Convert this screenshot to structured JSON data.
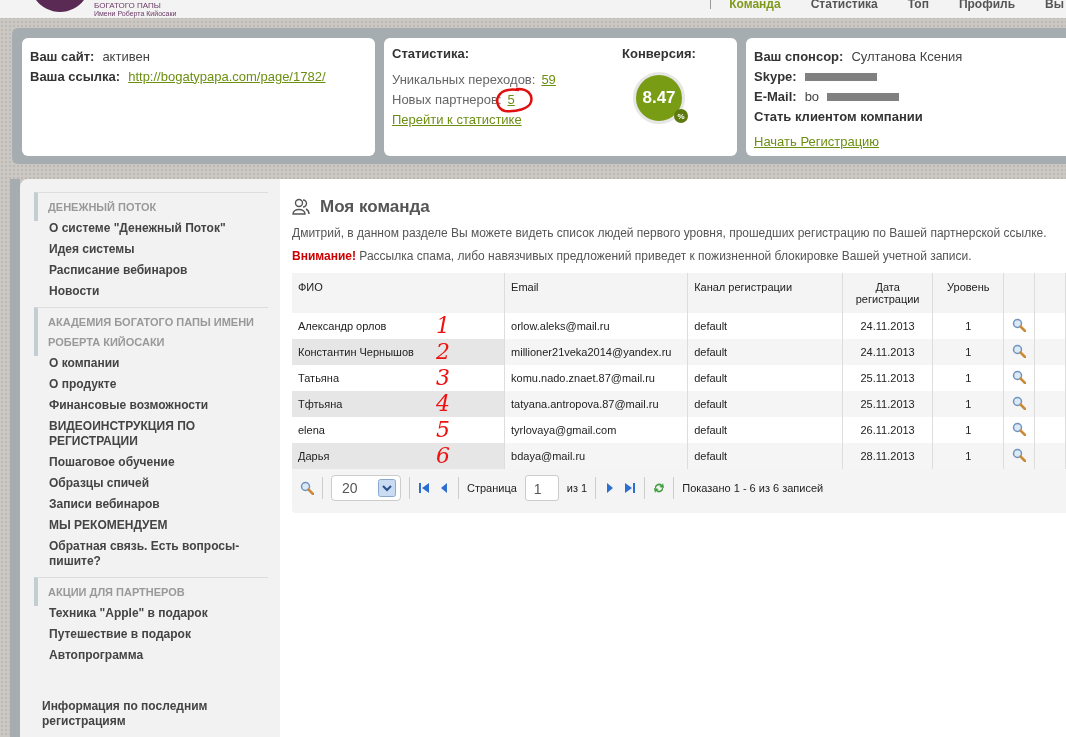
{
  "logo": {
    "lines": [
      "БОГАТОГО ПАПЫ",
      "Имени Роберта Кийосаки"
    ]
  },
  "nav": [
    {
      "label": "Команда",
      "selected": true
    },
    {
      "label": "Статистика",
      "selected": false
    },
    {
      "label": "Топ",
      "selected": false
    },
    {
      "label": "Профиль",
      "selected": false
    },
    {
      "label": "Вы",
      "selected": false
    }
  ],
  "site_card": {
    "rows": [
      {
        "label": "Ваш сайт:",
        "value": "активен",
        "kind": "text"
      },
      {
        "label": "Ваша ссылка:",
        "value": "http://bogatypapa.com/page/1782/",
        "kind": "link"
      }
    ]
  },
  "stats_card": {
    "title": "Статистика:",
    "rows": [
      {
        "label": "Уникальных переходов:",
        "value": "59",
        "circled": false
      },
      {
        "label": "Новых партнеров:",
        "value": "5",
        "circled": true
      }
    ],
    "link": "Перейти к статистике",
    "conversion": {
      "title": "Конверсия:",
      "value": "8.47",
      "unit": "%"
    }
  },
  "sponsor_card": {
    "rows": [
      {
        "label": "Ваш спонсор:",
        "value": "Султанова Ксения",
        "redacted": false
      },
      {
        "label": "Skype:",
        "value": "",
        "redacted": true
      },
      {
        "label": "E-Mail:",
        "value": "bo",
        "redacted": true
      }
    ],
    "note": "Стать клиентом компании",
    "link": "Начать Регистрацию"
  },
  "sidebar": {
    "sections": [
      {
        "title": "ДЕНЕЖНЫЙ ПОТОК",
        "items": [
          "О системе \"Денежный Поток\"",
          "Идея системы",
          "Расписание вебинаров",
          "Новости"
        ]
      },
      {
        "title": "АКАДЕМИЯ БОГАТОГО ПАПЫ ИМЕНИ РОБЕРТА КИЙОСАКИ",
        "items": [
          "О компании",
          "О продукте",
          "Финансовые возможности",
          "ВИДЕОИНСТРУКЦИЯ ПО РЕГИСТРАЦИИ",
          "Пошаговое обучение",
          "Образцы спичей",
          "Записи вебинаров",
          "МЫ РЕКОМЕНДУЕМ",
          "Обратная связь. Есть вопросы-пишите?"
        ]
      },
      {
        "title": "АКЦИИ ДЛЯ ПАРТНЕРОВ",
        "items": [
          "Техника \"Apple\" в подарок",
          "Путешествие в подарок",
          "Автопрограмма"
        ]
      }
    ],
    "footer": "Информация по последним регистрациям"
  },
  "main": {
    "title": "Моя команда",
    "intro": "Дмитрий, в данном разделе Вы можете видеть список людей первого уровня, прошедших регистрацию по Вашей партнерской ссылке.",
    "warning": "**Внимание!** Рассылка спама, либо навязчивых предложений приведет к пожизненной блокировке Вашей учетной записи."
  },
  "table": {
    "columns": [
      "ФИО",
      "Email",
      "Канал регистрации",
      "Дата регистрации",
      "Уровень"
    ],
    "rows": [
      {
        "cells": [
          "Александр орлов",
          "orlow.aleks@mail.ru",
          "default",
          "24.11.2013",
          "1"
        ],
        "annotation": "1"
      },
      {
        "cells": [
          "Константин Чернышов",
          "millioner21veka2014@yandex.ru",
          "default",
          "24.11.2013",
          "1"
        ],
        "annotation": "2"
      },
      {
        "cells": [
          "Татьяна",
          "komu.nado.znaet.87@mail.ru",
          "default",
          "25.11.2013",
          "1"
        ],
        "annotation": "3"
      },
      {
        "cells": [
          "Тфтьяна",
          "tatyana.antropova.87@mail.ru",
          "default",
          "25.11.2013",
          "1"
        ],
        "annotation": "4"
      },
      {
        "cells": [
          "elena",
          "tyrlovaya@gmail.com",
          "default",
          "26.11.2013",
          "1"
        ],
        "annotation": "5"
      },
      {
        "cells": [
          "Дарья",
          "bdaya@mail.ru",
          "default",
          "28.11.2013",
          "1"
        ],
        "annotation": "6"
      }
    ]
  },
  "pager": {
    "page_size": "20",
    "page_label": "Страница",
    "page": "1",
    "of": "из 1",
    "summary": "Показано 1 - 6 из 6 записей"
  }
}
